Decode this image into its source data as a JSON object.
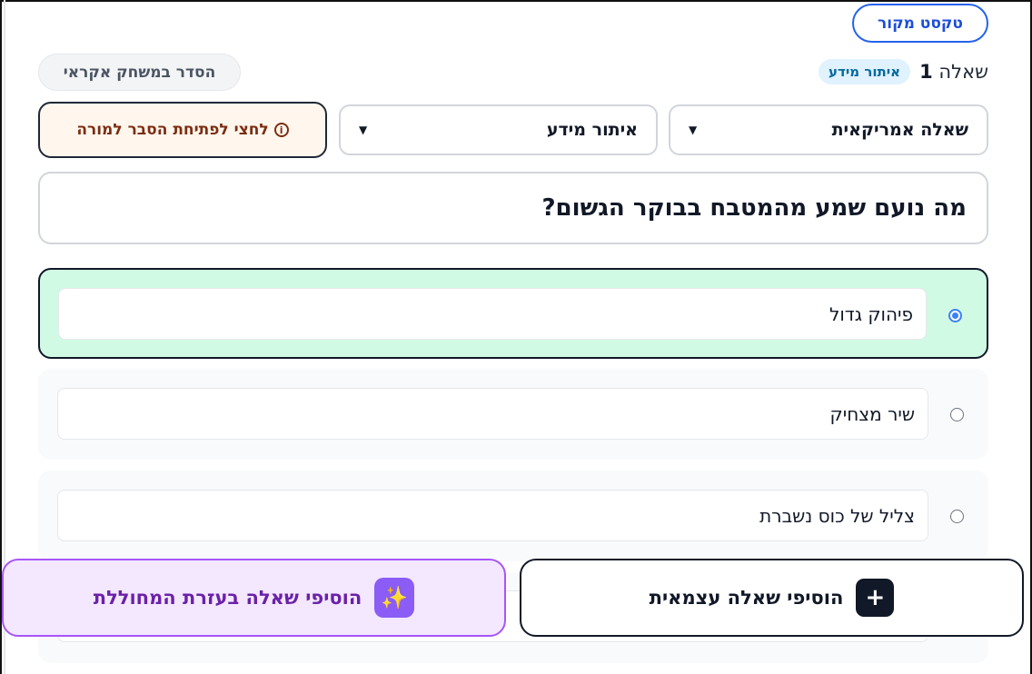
{
  "toolbar": {
    "source_text_label": "טקסט מקור",
    "shuffle_label": "הסדר במשחק אקראי"
  },
  "question": {
    "prefix": "שאלה",
    "number": "1",
    "tag": "איתור מידע",
    "type_select_value": "שאלה אמריקאית",
    "category_select_value": "איתור מידע",
    "teacher_hint_label": "לחצי לפתיחת הסבר למורה",
    "text": "מה נועם שמע מהמטבח בבוקר הגשום?"
  },
  "answers": [
    {
      "text": "פיהוק גדול",
      "correct": true
    },
    {
      "text": "שיר מצחיק",
      "correct": false
    },
    {
      "text": "צליל של כוס נשברת",
      "correct": false
    }
  ],
  "actions": {
    "add_self_label": "הוסיפי שאלה עצמאית",
    "add_ai_label": "הוסיפי שאלה בעזרת המחוללת"
  },
  "icons": {
    "info": "info-icon",
    "chevron": "chevron-down-icon",
    "sparkle": "sparkle-icon",
    "plus": "plus-icon"
  },
  "colors": {
    "accent_blue": "#2563eb",
    "correct_bg": "#d1fae5",
    "ai_purple": "#8b5cf6",
    "hint_bg": "#fff7ed"
  }
}
